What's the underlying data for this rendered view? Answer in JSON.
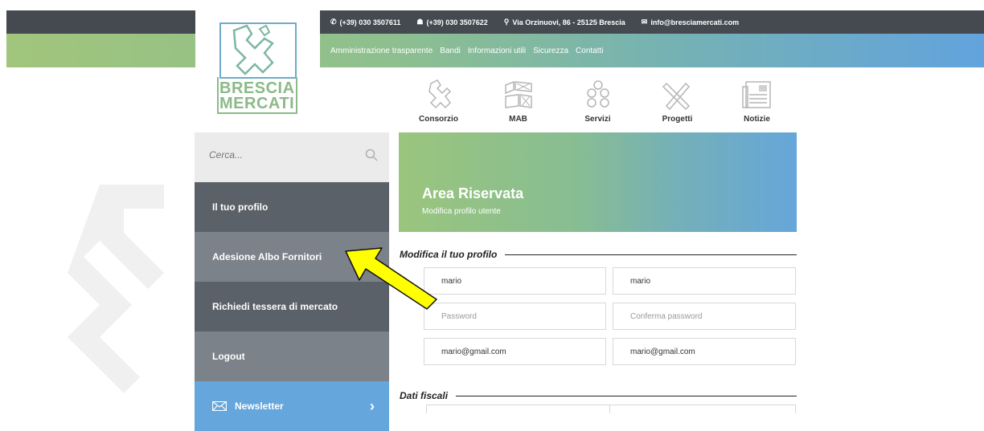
{
  "header": {
    "logo": {
      "line1": "BRESCIA",
      "line2": "MERCATI"
    },
    "contacts": [
      {
        "icon": "phone-icon",
        "glyph": "✆",
        "text": "(+39) 030 3507611"
      },
      {
        "icon": "fax-icon",
        "glyph": "☗",
        "text": "(+39) 030 3507622"
      },
      {
        "icon": "location-icon",
        "glyph": "⚲",
        "text": "Via Orzinuovi, 86 - 25125 Brescia"
      },
      {
        "icon": "mail-icon",
        "glyph": "✉",
        "text": "info@bresciamercati.com"
      }
    ],
    "links": [
      "Amministrazione trasparente",
      "Bandi",
      "Informazioni utili",
      "Sicurezza",
      "Contatti"
    ]
  },
  "nav": [
    {
      "label": "Consorzio",
      "icon": "lion-icon"
    },
    {
      "label": "MAB",
      "icon": "market-map-icon"
    },
    {
      "label": "Servizi",
      "icon": "services-hexagons-icon"
    },
    {
      "label": "Progetti",
      "icon": "pencil-ruler-icon"
    },
    {
      "label": "Notizie",
      "icon": "newspaper-icon"
    }
  ],
  "sidebar": {
    "search_placeholder": "Cerca...",
    "items": [
      {
        "label": "Il tuo profilo"
      },
      {
        "label": "Adesione Albo Fornitori"
      },
      {
        "label": "Richiedi tessera di mercato"
      },
      {
        "label": "Logout"
      }
    ],
    "newsletter": {
      "label": "Newsletter",
      "chevron": "›"
    }
  },
  "hero": {
    "title": "Area Riservata",
    "subtitle": "Modifica profilo utente"
  },
  "form": {
    "section_title": "Modifica il tuo profilo",
    "first_name": "mario",
    "last_name": "mario",
    "password_placeholder": "Password",
    "confirm_password_placeholder": "Conferma password",
    "email": "mario@gmail.com",
    "confirm_email": "mario@gmail.com",
    "fiscal_section_title": "Dati fiscali"
  },
  "colors": {
    "accent_green": "#9ac57d",
    "accent_blue": "#65a6dc",
    "sidebar_dark": "#5b6168",
    "sidebar_light": "#7c8289",
    "annotation_arrow": "#ffff00"
  }
}
